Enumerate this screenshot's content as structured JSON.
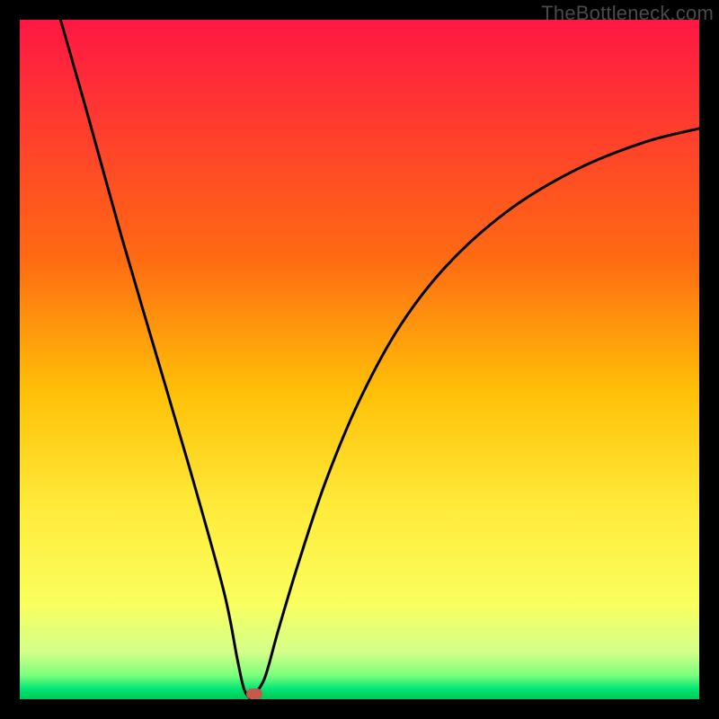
{
  "watermark": "TheBottleneck.com",
  "chart_data": {
    "type": "line",
    "title": "",
    "xlabel": "",
    "ylabel": "",
    "xlim": [
      0,
      100
    ],
    "ylim": [
      0,
      100
    ],
    "grid": false,
    "legend": false,
    "background_gradient": {
      "stops": [
        {
          "pos": 0.0,
          "color": "#ff1744"
        },
        {
          "pos": 0.35,
          "color": "#ff6a13"
        },
        {
          "pos": 0.55,
          "color": "#ffc107"
        },
        {
          "pos": 0.72,
          "color": "#ffeb3b"
        },
        {
          "pos": 0.86,
          "color": "#faff5e"
        },
        {
          "pos": 0.93,
          "color": "#d4ff8a"
        },
        {
          "pos": 0.965,
          "color": "#7cff7c"
        },
        {
          "pos": 0.985,
          "color": "#00e676"
        },
        {
          "pos": 1.0,
          "color": "#00c853"
        }
      ]
    },
    "curve": {
      "minimum_x": 34,
      "minimum_y": 0,
      "left_branch": [
        {
          "x": 6,
          "y": 100
        },
        {
          "x": 10,
          "y": 86
        },
        {
          "x": 15,
          "y": 68
        },
        {
          "x": 20,
          "y": 51
        },
        {
          "x": 25,
          "y": 34
        },
        {
          "x": 30,
          "y": 16
        },
        {
          "x": 32,
          "y": 6
        },
        {
          "x": 33,
          "y": 1.5
        },
        {
          "x": 34,
          "y": 0
        }
      ],
      "right_branch": [
        {
          "x": 34,
          "y": 0
        },
        {
          "x": 36,
          "y": 3
        },
        {
          "x": 38,
          "y": 10
        },
        {
          "x": 41,
          "y": 20
        },
        {
          "x": 45,
          "y": 32
        },
        {
          "x": 50,
          "y": 44
        },
        {
          "x": 56,
          "y": 55
        },
        {
          "x": 63,
          "y": 64
        },
        {
          "x": 72,
          "y": 72
        },
        {
          "x": 82,
          "y": 78
        },
        {
          "x": 92,
          "y": 82
        },
        {
          "x": 100,
          "y": 84
        }
      ]
    },
    "marker": {
      "x": 34.5,
      "y": 0.5,
      "color": "#c45a4a"
    }
  }
}
